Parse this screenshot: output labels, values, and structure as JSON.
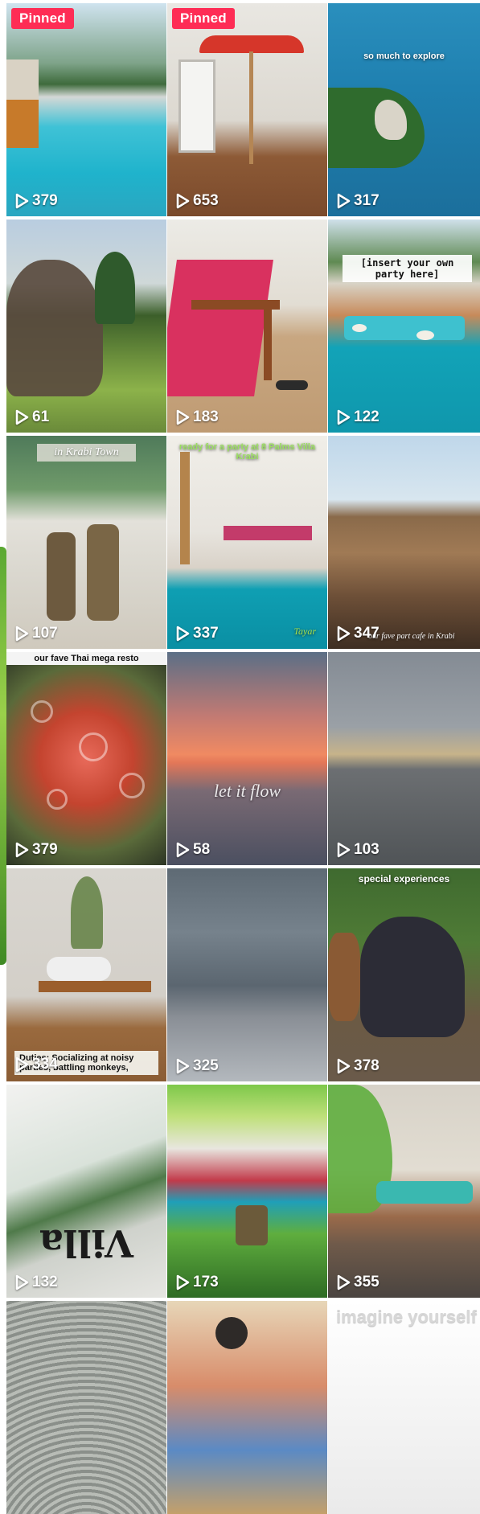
{
  "profile_grid": {
    "pinned_label": "Pinned",
    "tiles": [
      {
        "views": "379",
        "pinned": true
      },
      {
        "views": "653",
        "pinned": true
      },
      {
        "views": "317",
        "caption": "so much to explore"
      },
      {
        "views": "61"
      },
      {
        "views": "183"
      },
      {
        "views": "122",
        "caption": "[insert your own party here]"
      },
      {
        "views": "107",
        "caption": "in Krabi Town"
      },
      {
        "views": "337",
        "caption": "ready for a party at 8 Palms Villa Krabi",
        "caption2": "Tayar"
      },
      {
        "views": "347",
        "caption": "our fave part cafe in Krabi"
      },
      {
        "views": "379",
        "caption": "our fave Thai mega resto"
      },
      {
        "views": "58",
        "caption": "let it flow"
      },
      {
        "views": "103"
      },
      {
        "views": "334",
        "caption": "Duties: Socializing at noisy parties, battling monkeys,"
      },
      {
        "views": "325"
      },
      {
        "views": "378",
        "caption": "special experiences"
      },
      {
        "views": "132",
        "caption": "Villa"
      },
      {
        "views": "173"
      },
      {
        "views": "355"
      },
      {
        "views": ""
      },
      {
        "views": ""
      },
      {
        "views": "",
        "caption": "imagine yourself"
      }
    ]
  },
  "icons": {
    "play": "play-outline-icon"
  },
  "colors": {
    "pinned_badge": "#fe2c55",
    "view_text": "#ffffff"
  }
}
